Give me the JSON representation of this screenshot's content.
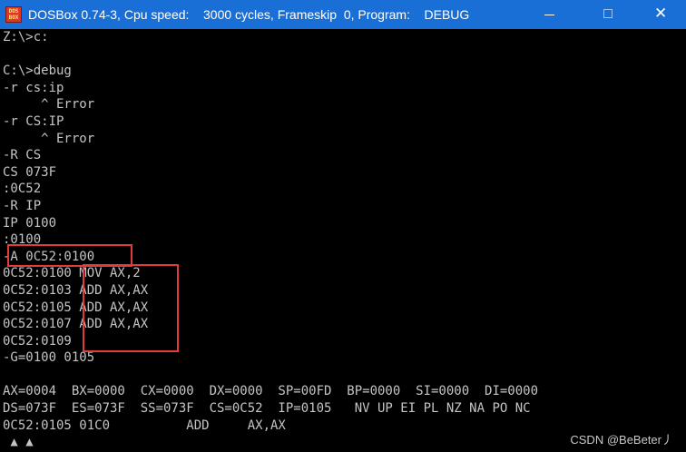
{
  "window": {
    "title": "DOSBox 0.74-3, Cpu speed:    3000 cycles, Frameskip  0, Program:    DEBUG",
    "icon_top_text": "DOS",
    "icon_bottom_text": "BOX",
    "icon_colors": {
      "background": "#e0352b",
      "text": "#ffe66d"
    }
  },
  "terminal": {
    "lines": [
      "Z:\\>c:",
      "",
      "C:\\>debug",
      "-r cs:ip",
      "     ^ Error",
      "-r CS:IP",
      "     ^ Error",
      "-R CS",
      "CS 073F",
      ":0C52",
      "-R IP",
      "IP 0100",
      ":0100",
      "-A 0C52:0100",
      "0C52:0100 MOV AX,2",
      "0C52:0103 ADD AX,AX",
      "0C52:0105 ADD AX,AX",
      "0C52:0107 ADD AX,AX",
      "0C52:0109",
      "-G=0100 0105",
      "",
      "AX=0004  BX=0000  CX=0000  DX=0000  SP=00FD  BP=0000  SI=0000  DI=0000",
      "DS=073F  ES=073F  SS=073F  CS=0C52  IP=0105   NV UP EI PL NZ NA PO NC",
      "0C52:0105 01C0          ADD     AX,AX",
      " ▲ ▲"
    ],
    "text_color": "#c4c4c4",
    "highlight_color": "#e23b3b"
  },
  "watermark": "CSDN @BeBeter丿"
}
